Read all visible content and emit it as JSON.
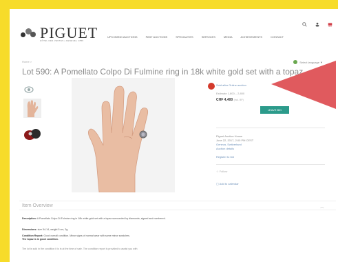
{
  "header": {
    "logo_text": "PIGUET",
    "logo_subtitle": "HÔTEL DES VENTES | GENEVE | 1856",
    "nav": [
      "UPCOMING AUCTIONS",
      "PAST AUCTIONS",
      "SPECIALTIES",
      "SERVICES",
      "MEDIA",
      "ACHIEVEMENTS",
      "CONTACT"
    ],
    "icons": [
      "search-icon",
      "user-icon",
      "cart-icon"
    ]
  },
  "breadcrumb": "Home >",
  "language": "Select language ▼",
  "lot_title": "Lot 590: A Pomellato Colpo Di Fulmine ring in 18k white gold set with a topaz",
  "bidding": {
    "status": "Sold after Online auction",
    "estimate": "Estimate 1,800 – 2,800",
    "price": "CHF 4,400",
    "price_note": "(incl. BP)",
    "leave_bid_label": "LEAVE BID"
  },
  "sale": {
    "name": "Piguet Auction House",
    "date": "June 22, 2017, 2:00 PM CEST",
    "location": "Geneva, Switzerland",
    "details": "Auction details",
    "register": "Register to bid"
  },
  "follow": "Follow",
  "calendar": "Add to calendar",
  "overview": {
    "header": "Item Overview",
    "description_label": "Description:",
    "description": "A Pomellato Colpo Di Fulmine ring in 18k white gold set with a topaz surrounded by diamonds, signed and numbered.",
    "dimensions_label": "Dimensions:",
    "dimensions": "size 54-14, weight 5 cm, 3g",
    "condition_label": "Condition Report:",
    "condition": "Good overall condition. Minor signs of normal wear with some minor scratches.",
    "condition2": "The topaz is in good condition.",
    "disclaimer": "The lot is sold in the condition it is in at the time of sale. The condition report is provided to assist you with"
  }
}
